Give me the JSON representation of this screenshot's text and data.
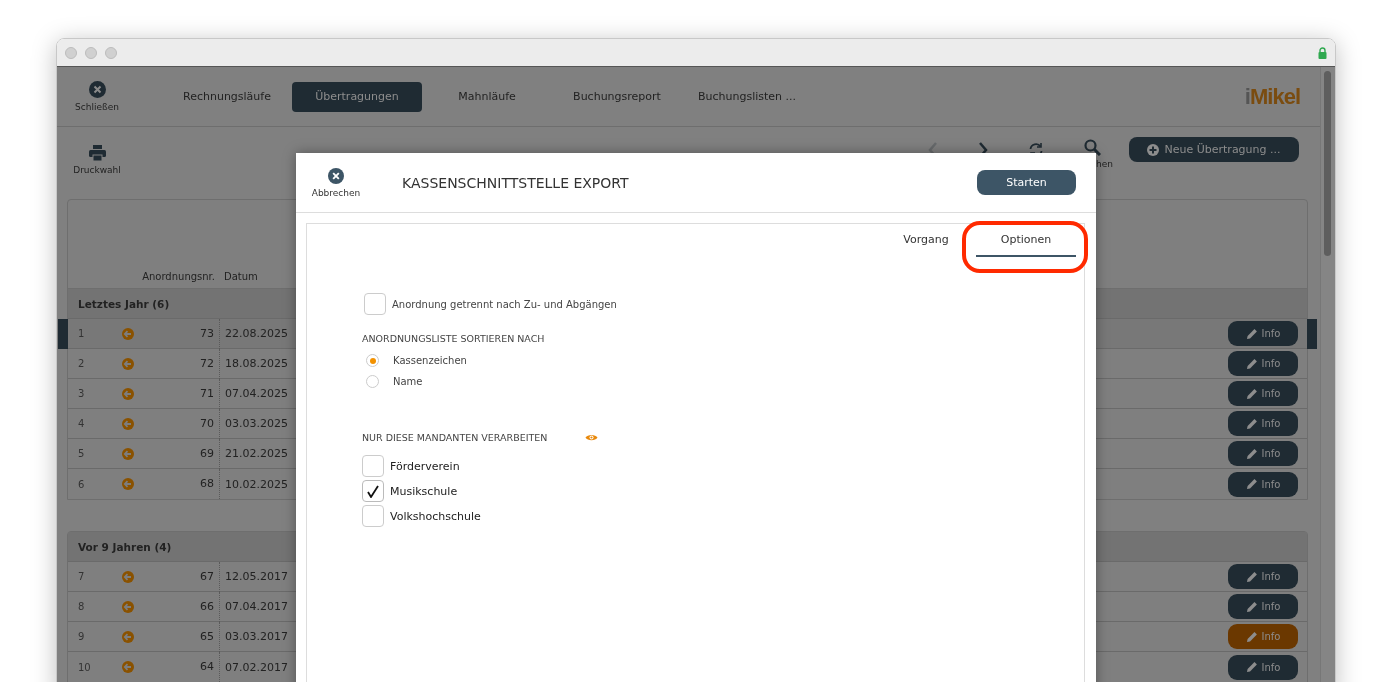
{
  "toolbar": {
    "close_label": "Schließen",
    "tabs": [
      {
        "label": "Rechnungsläufe",
        "selected": false
      },
      {
        "label": "Übertragungen",
        "selected": true
      },
      {
        "label": "Mahnläufe",
        "selected": false
      },
      {
        "label": "Buchungsreport",
        "selected": false
      },
      {
        "label": "Buchungslisten ...",
        "selected": false
      }
    ],
    "logo": "iMikel"
  },
  "actionbar": {
    "print_label": "Druckwahl",
    "back_disabled": true,
    "search_label": "hen",
    "new_button": "Neue Übertragung ..."
  },
  "table": {
    "columns": [
      "Anordnungsnr.",
      "Datum"
    ],
    "groups": [
      {
        "title": "Letztes Jahr (6)",
        "rows": [
          {
            "index": "1",
            "nr": "73",
            "date": "22.08.2025",
            "selected": true,
            "highlighted": false,
            "button": "Info"
          },
          {
            "index": "2",
            "nr": "72",
            "date": "18.08.2025",
            "selected": false,
            "highlighted": false,
            "button": "Info"
          },
          {
            "index": "3",
            "nr": "71",
            "date": "07.04.2025",
            "selected": false,
            "highlighted": false,
            "button": "Info"
          },
          {
            "index": "4",
            "nr": "70",
            "date": "03.03.2025",
            "selected": false,
            "highlighted": false,
            "button": "Info"
          },
          {
            "index": "5",
            "nr": "69",
            "date": "21.02.2025",
            "selected": false,
            "highlighted": false,
            "button": "Info"
          },
          {
            "index": "6",
            "nr": "68",
            "date": "10.02.2025",
            "selected": false,
            "highlighted": false,
            "button": "Info"
          }
        ]
      },
      {
        "title": "Vor 9 Jahren (4)",
        "rows": [
          {
            "index": "7",
            "nr": "67",
            "date": "12.05.2017",
            "selected": false,
            "highlighted": false,
            "button": "Info"
          },
          {
            "index": "8",
            "nr": "66",
            "date": "07.04.2017",
            "selected": false,
            "highlighted": false,
            "button": "Info"
          },
          {
            "index": "9",
            "nr": "65",
            "date": "03.03.2017",
            "selected": false,
            "highlighted": true,
            "button": "Info"
          },
          {
            "index": "10",
            "nr": "64",
            "date": "07.02.2017",
            "selected": false,
            "highlighted": false,
            "button": "Info"
          }
        ]
      }
    ]
  },
  "dialog": {
    "cancel_label": "Abbrechen",
    "title": "KASSENSCHNITTSTELLE EXPORT",
    "start_button": "Starten",
    "tabs": [
      {
        "label": "Vorgang",
        "selected": false,
        "annotated": false
      },
      {
        "label": "Optionen",
        "selected": true,
        "annotated": true
      }
    ],
    "split_option": {
      "label": "Anordnung getrennt nach Zu- und Abgängen",
      "checked": false
    },
    "sort": {
      "heading": "ANORDNUNGSLISTE SORTIEREN NACH",
      "options": [
        {
          "label": "Kassenzeichen",
          "selected": true
        },
        {
          "label": "Name",
          "selected": false
        }
      ]
    },
    "clients": {
      "heading": "NUR DIESE MANDANTEN VERARBEITEN",
      "items": [
        {
          "label": "Förderverein",
          "checked": false
        },
        {
          "label": "Musikschule",
          "checked": true
        },
        {
          "label": "Volkshochschule",
          "checked": false
        }
      ]
    }
  }
}
